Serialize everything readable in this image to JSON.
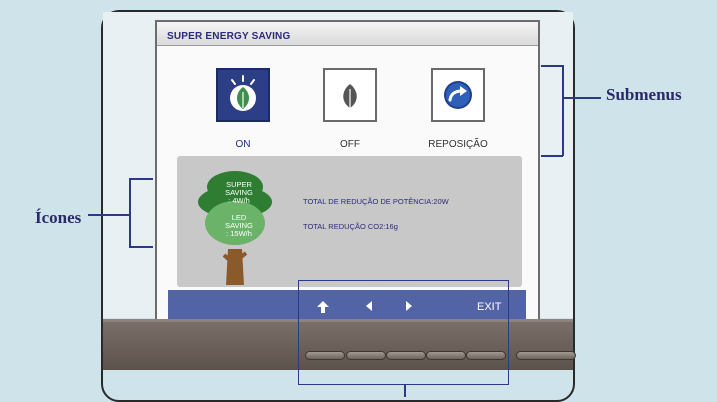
{
  "osd": {
    "title": "SUPER ENERGY SAVING",
    "options": [
      {
        "label": "ON",
        "icon": "leaf-icon",
        "selected": true
      },
      {
        "label": "OFF",
        "icon": "leaf-icon",
        "selected": false
      },
      {
        "label": "REPOSIÇÃO",
        "icon": "reset-arrow-icon",
        "selected": false
      }
    ],
    "tree": {
      "super_line1": "SUPER",
      "super_line2": "SAVING",
      "super_value": ": 4W/h",
      "led_line1": "LED",
      "led_line2": "SAVING",
      "led_value": ": 15W/h"
    },
    "stats": {
      "power_reduction": "TOTAL DE REDUÇÃO DE POTÊNCIA:20W",
      "co2_reduction": "TOTAL REDUÇÃO CO2:16g"
    },
    "nav": {
      "up_icon": "up-arrow-icon",
      "left_icon": "left-arrow-icon",
      "right_icon": "right-arrow-icon",
      "exit_label": "EXIT"
    }
  },
  "annotations": {
    "submenus": "Submenus",
    "icones": "Ícones"
  },
  "colors": {
    "accent": "#2c3f86",
    "nav_bar": "#5263a6",
    "tree_green": "#4e9a4e",
    "callout": "#2a3a86"
  }
}
